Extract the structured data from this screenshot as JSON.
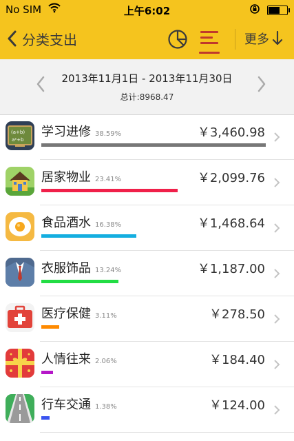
{
  "status_bar": {
    "carrier": "No SIM",
    "time": "上午6:02"
  },
  "nav": {
    "back_label": "分类支出",
    "more_label": "更多"
  },
  "range": {
    "date_range": "2013年11月1日 - 2013年11月30日",
    "total": "总计:8968.47"
  },
  "categories": [
    {
      "name": "学习进修",
      "percent": "38.59%",
      "amount": "￥3,460.98",
      "bar_fraction": 1.0,
      "color": "#777777",
      "icon": "chalkboard-icon"
    },
    {
      "name": "居家物业",
      "percent": "23.41%",
      "amount": "￥2,099.76",
      "bar_fraction": 0.607,
      "color": "#f0204a",
      "icon": "house-icon"
    },
    {
      "name": "食品酒水",
      "percent": "16.38%",
      "amount": "￥1,468.64",
      "bar_fraction": 0.424,
      "color": "#14aee0",
      "icon": "fried-egg-icon"
    },
    {
      "name": "衣服饰品",
      "percent": "13.24%",
      "amount": "￥1,187.00",
      "bar_fraction": 0.343,
      "color": "#22dd44",
      "icon": "suit-icon"
    },
    {
      "name": "医疗保健",
      "percent": "3.11%",
      "amount": "￥278.50",
      "bar_fraction": 0.08,
      "color": "#ff8a00",
      "icon": "first-aid-kit-icon"
    },
    {
      "name": "人情往来",
      "percent": "2.06%",
      "amount": "￥184.40",
      "bar_fraction": 0.053,
      "color": "#b517c8",
      "icon": "gift-icon"
    },
    {
      "name": "行车交通",
      "percent": "1.38%",
      "amount": "￥124.00",
      "bar_fraction": 0.036,
      "color": "#3a54f0",
      "icon": "road-icon"
    }
  ]
}
